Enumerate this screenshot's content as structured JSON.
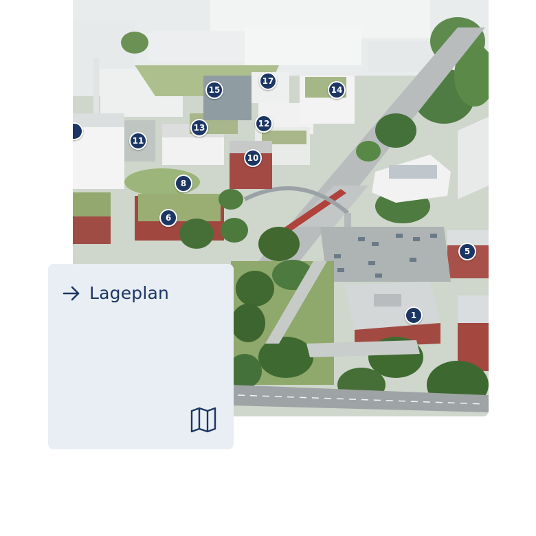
{
  "card": {
    "title": "Lageplan",
    "arrow_icon": "arrow-right-icon",
    "map_icon": "folded-map-icon"
  },
  "colors": {
    "accent": "#1c3664",
    "card_background": "#e8eef4",
    "marker_text": "#ffffff"
  },
  "site_plan": {
    "image_description_kind": "aerial-campus-rendering",
    "markers": [
      {
        "id": "m1",
        "label": "1"
      },
      {
        "id": "m5",
        "label": "5"
      },
      {
        "id": "m6",
        "label": "6"
      },
      {
        "id": "m8",
        "label": "8"
      },
      {
        "id": "m10",
        "label": "10"
      },
      {
        "id": "m11",
        "label": "11"
      },
      {
        "id": "m12",
        "label": "12"
      },
      {
        "id": "m13",
        "label": "13"
      },
      {
        "id": "m14",
        "label": "14"
      },
      {
        "id": "m15",
        "label": "15"
      },
      {
        "id": "m17",
        "label": "17"
      },
      {
        "id": "m-edge",
        "label": ""
      }
    ]
  }
}
